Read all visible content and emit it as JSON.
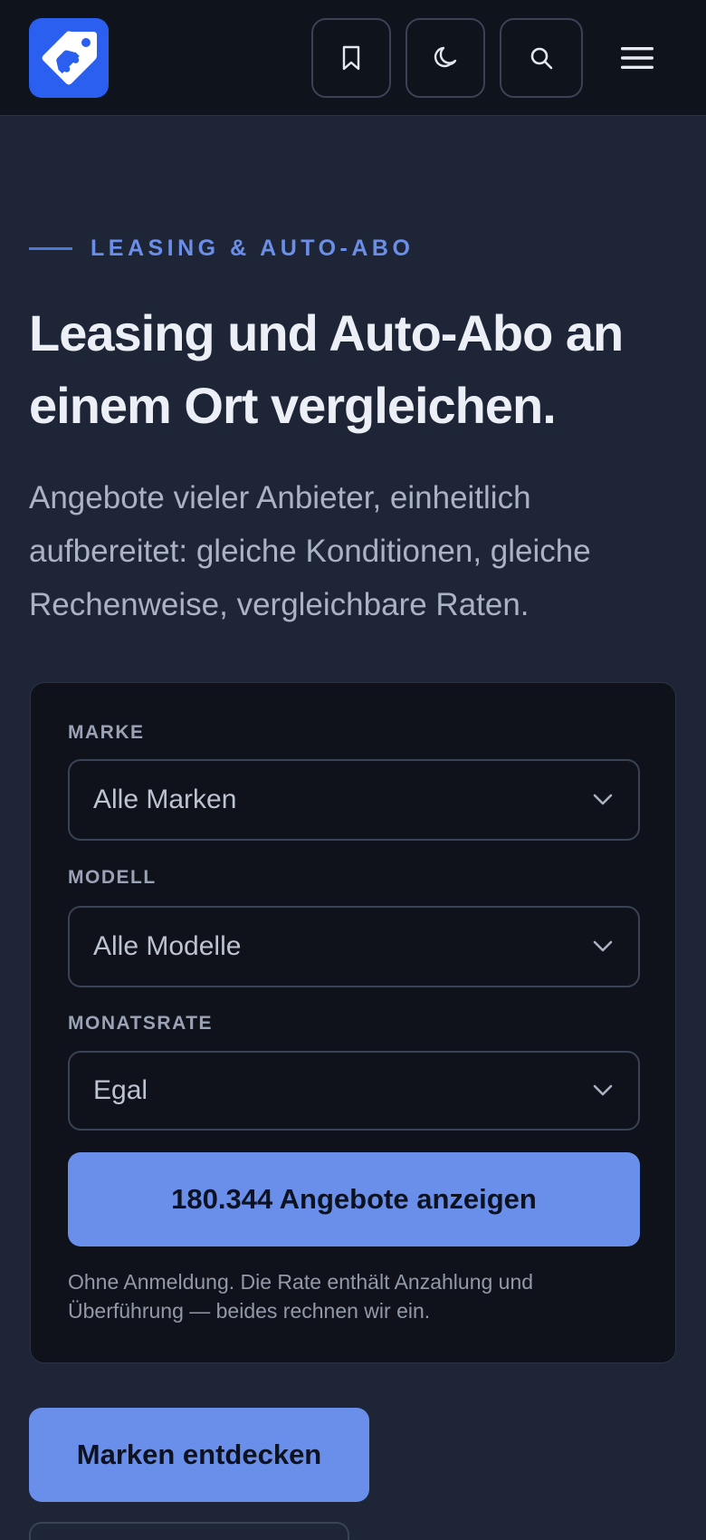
{
  "header": {
    "logo_icon": "car-tag-icon",
    "buttons": [
      {
        "icon": "bookmark-icon"
      },
      {
        "icon": "moon-icon"
      },
      {
        "icon": "search-icon"
      }
    ],
    "menu_icon": "hamburger-icon"
  },
  "hero": {
    "eyebrow": "LEASING & AUTO-ABO",
    "headline": "Leasing und Auto-Abo an einem Ort vergleichen.",
    "lead": "Angebote vieler Anbieter, einheitlich aufbereitet: gleiche Konditionen, gleiche Rechenweise, vergleichbare Raten."
  },
  "search": {
    "fields": [
      {
        "label": "MARKE",
        "value": "Alle Marken"
      },
      {
        "label": "MODELL",
        "value": "Alle Modelle"
      },
      {
        "label": "MONATSRATE",
        "value": "Egal"
      }
    ],
    "submit_label": "180.344 Angebote anzeigen",
    "note": "Ohne Anmeldung. Die Rate enthält Anzahlung und Überführung — beides rechnen wir ein."
  },
  "secondary_button": "Marken entdecken",
  "colors": {
    "background": "#1d2537",
    "header": "#0f131c",
    "accent": "#6a8fea",
    "logo": "#2a5ff0"
  }
}
